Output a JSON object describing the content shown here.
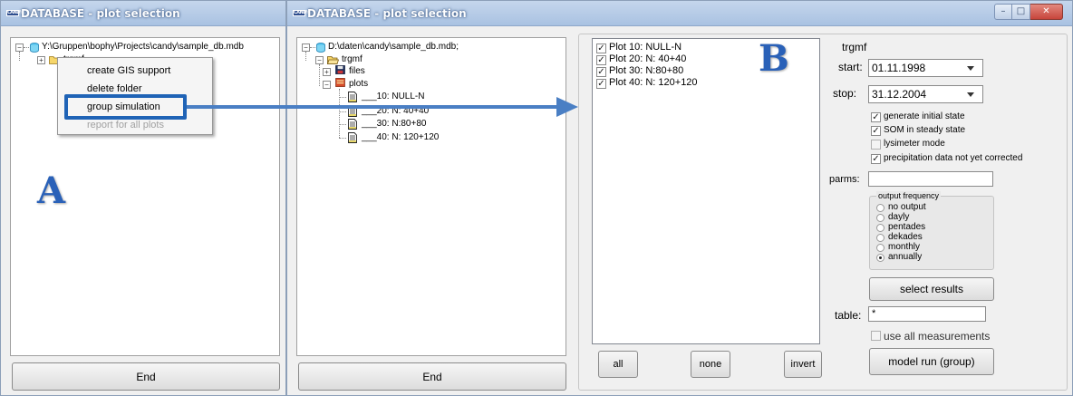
{
  "window_left": {
    "title": "DATABASE - plot selection",
    "app_icon_text": "CANDY",
    "tree": {
      "root_path": "Y:\\Gruppen\\bophy\\Projects\\candy\\sample_db.mdb",
      "child": "trgmf"
    },
    "context_menu": [
      {
        "label": "create GIS support",
        "enabled": true
      },
      {
        "label": "delete folder",
        "enabled": true
      },
      {
        "label": "group simulation",
        "enabled": true,
        "highlighted": true
      },
      {
        "label": "report for all plots",
        "enabled": false
      }
    ],
    "marker": "A",
    "end_label": "End"
  },
  "window_right": {
    "title": "DATABASE - plot selection",
    "app_icon_text": "CANDY",
    "tree": {
      "root_path": "D:\\daten\\candy\\sample_db.mdb;",
      "folder": "trgmf",
      "files_label": "files",
      "plots_label": "plots",
      "plots": [
        "___10: NULL-N",
        "___20: N: 40+40",
        "___30: N:80+80",
        "___40: N: 120+120"
      ]
    },
    "end_label": "End",
    "plot_list": [
      {
        "label": "Plot 10: NULL-N",
        "checked": true
      },
      {
        "label": "Plot 20: N: 40+40",
        "checked": true
      },
      {
        "label": "Plot 30: N:80+80",
        "checked": true
      },
      {
        "label": "Plot 40: N: 120+120",
        "checked": true
      }
    ],
    "marker": "B",
    "list_buttons": {
      "all": "all",
      "none": "none",
      "invert": "invert"
    },
    "settings": {
      "site": "trgmf",
      "start_label": "start:",
      "start_value": "01.11.1998",
      "stop_label": "stop:",
      "stop_value": "31.12.2004",
      "options": [
        {
          "label": "generate initial state",
          "checked": true
        },
        {
          "label": "SOM in steady state",
          "checked": true
        },
        {
          "label": "lysimeter mode",
          "checked": false
        },
        {
          "label": "precipitation data not yet corrected",
          "checked": true
        }
      ],
      "parms_label": "parms:",
      "parms_value": "",
      "output_frequency": {
        "legend": "output frequency",
        "options": [
          "no output",
          "dayly",
          "pentades",
          "dekades",
          "monthly",
          "annually"
        ],
        "selected": "annually"
      },
      "select_results_label": "select results",
      "table_label": "table:",
      "table_value": "*",
      "use_all_label": "use all measurements",
      "use_all_checked": false,
      "model_run_label": "model run (group)"
    },
    "window_controls": {
      "minimize": "–",
      "maximize": "□",
      "close": "✕"
    }
  },
  "colors": {
    "accent": "#2e6dbf",
    "highlight_box": "#1f63b6",
    "close_button": "#c7453b"
  }
}
